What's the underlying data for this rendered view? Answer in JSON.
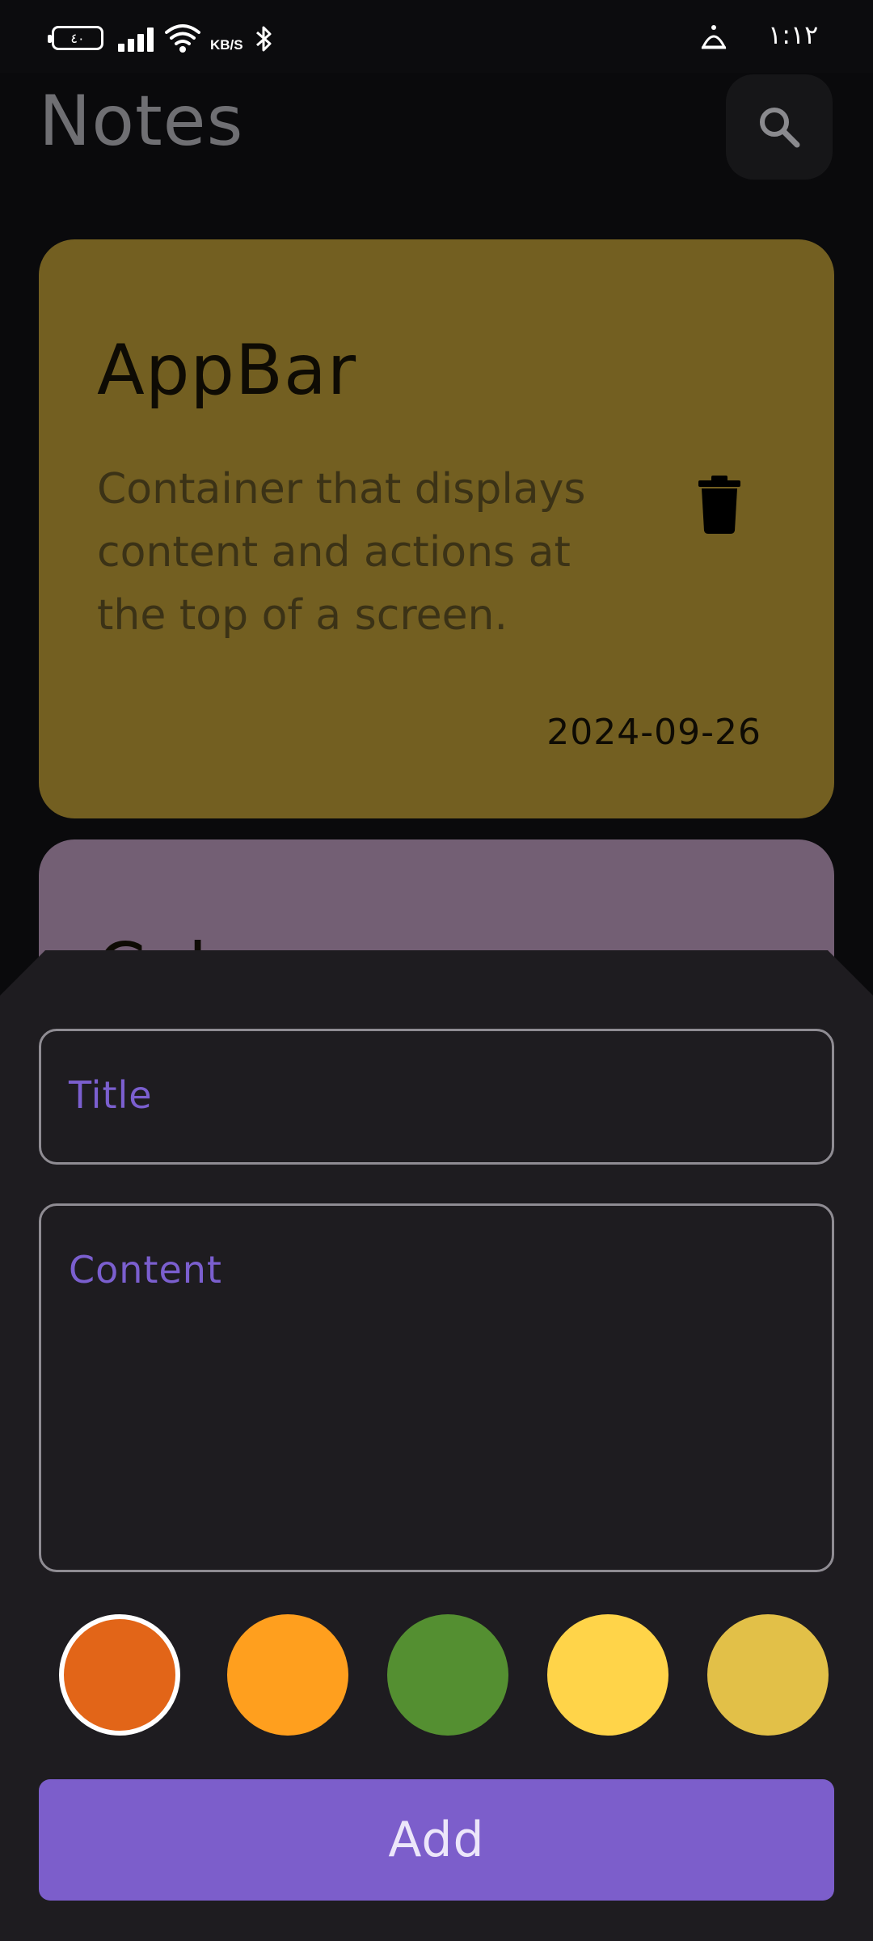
{
  "status_bar": {
    "battery_text": "٤٠",
    "network_speed_unit": "KB/S",
    "time": "١:١٢",
    "icons": [
      "battery-icon",
      "signal-icon",
      "wifi-icon",
      "bluetooth-icon",
      "alarm-icon"
    ]
  },
  "header": {
    "title": "Notes",
    "search_icon": "search-icon"
  },
  "notes": [
    {
      "title": "AppBar",
      "content": "Container that displays content and actions at the top of a screen.",
      "date": "2024-09-26",
      "color": "#735f21",
      "delete_icon": "trash-icon"
    },
    {
      "title": "Col",
      "color": "#735f74"
    }
  ],
  "sheet": {
    "title_placeholder": "Title",
    "content_placeholder": "Content",
    "colors": [
      {
        "hex": "#e26518",
        "selected": true
      },
      {
        "hex": "#ff9f1e",
        "selected": false
      },
      {
        "hex": "#548f31",
        "selected": false
      },
      {
        "hex": "#ffd449",
        "selected": false
      },
      {
        "hex": "#e2c048",
        "selected": false
      }
    ],
    "add_label": "Add"
  },
  "theme": {
    "accent": "#7c5ecb",
    "background": "#0a0a0c",
    "sheet_background": "#1e1c20"
  }
}
